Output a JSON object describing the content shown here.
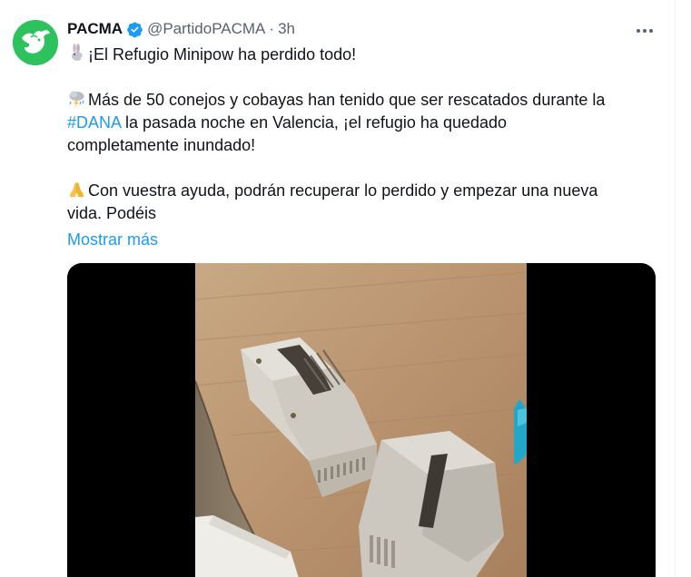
{
  "tweet": {
    "display_name": "PACMA",
    "handle": "@PartidoPACMA",
    "separator": "·",
    "time": "3h",
    "icons": {
      "avatar": "pacma-bull-logo",
      "verified": "verified-badge-icon",
      "more": "more-options-icon"
    },
    "text": {
      "line1_emoji": "rabbit-emoji",
      "line1": "¡El Refugio Minipow ha perdido todo!",
      "line2_emoji": "storm-cloud-emoji",
      "line2": "Más de 50 conejos y cobayas han tenido que ser rescatados durante la",
      "line3_hashtag": "#DANA",
      "line3_rest": " la pasada noche en Valencia, ¡el refugio ha quedado",
      "line4": "completamente inundado!",
      "line5_emoji": "folded-hands-emoji",
      "line5": "Con vuestra ayuda, podrán recuperar lo perdido y empezar una nueva",
      "line6": "vida. Podéis"
    },
    "show_more": "Mostrar más",
    "colors": {
      "brand_green": "#2ec25e",
      "link_blue": "#1d9bf0",
      "muted": "#536471"
    },
    "media": {
      "type": "video",
      "description_icon": "video-thumbnail"
    }
  }
}
